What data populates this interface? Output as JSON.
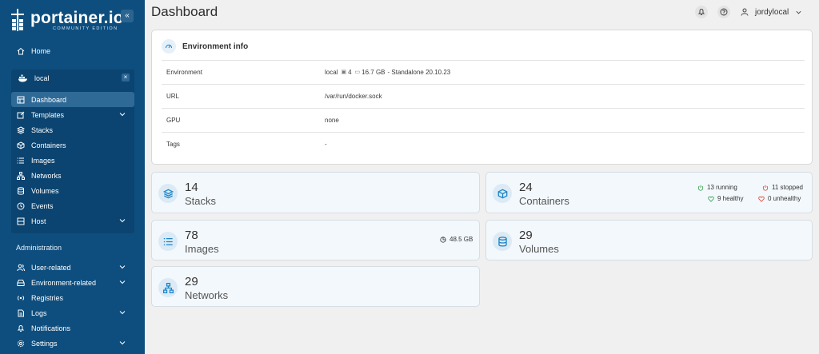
{
  "brand": {
    "name": "portainer.io",
    "edition": "COMMUNITY EDITION"
  },
  "sidebar": {
    "collapse_icon": "«",
    "home": "Home",
    "environment": {
      "name": "local",
      "close": "×"
    },
    "env_items": [
      {
        "label": "Dashboard",
        "icon": "dashboard-icon",
        "active": true
      },
      {
        "label": "Templates",
        "icon": "edit-icon",
        "chevron": true
      },
      {
        "label": "Stacks",
        "icon": "layers-icon"
      },
      {
        "label": "Containers",
        "icon": "box-icon"
      },
      {
        "label": "Images",
        "icon": "list-icon"
      },
      {
        "label": "Networks",
        "icon": "network-icon"
      },
      {
        "label": "Volumes",
        "icon": "database-icon"
      },
      {
        "label": "Events",
        "icon": "clock-icon"
      },
      {
        "label": "Host",
        "icon": "server-icon",
        "chevron": true
      }
    ],
    "admin_title": "Administration",
    "admin_items": [
      {
        "label": "User-related",
        "chevron": true
      },
      {
        "label": "Environment-related",
        "chevron": true
      },
      {
        "label": "Registries"
      },
      {
        "label": "Logs",
        "chevron": true
      },
      {
        "label": "Notifications"
      },
      {
        "label": "Settings",
        "chevron": true
      }
    ]
  },
  "header": {
    "title": "Dashboard",
    "username": "jordylocal"
  },
  "env_info": {
    "title": "Environment info",
    "rows": [
      {
        "key": "Environment",
        "name": "local",
        "cpu": "4",
        "mem": "16.7 GB",
        "rest": "- Standalone 20.10.23"
      },
      {
        "key": "URL",
        "value": "/var/run/docker.sock"
      },
      {
        "key": "GPU",
        "value": "none"
      },
      {
        "key": "Tags",
        "value": "-"
      }
    ]
  },
  "stats": {
    "stacks": {
      "count": "14",
      "label": "Stacks"
    },
    "containers": {
      "count": "24",
      "label": "Containers",
      "running": "13 running",
      "stopped": "11 stopped",
      "healthy": "9 healthy",
      "unhealthy": "0 unhealthy"
    },
    "images": {
      "count": "78",
      "label": "Images",
      "size": "48.5 GB"
    },
    "volumes": {
      "count": "29",
      "label": "Volumes"
    },
    "networks": {
      "count": "29",
      "label": "Networks"
    }
  },
  "colors": {
    "sidebar": "#0e4e7e",
    "accent": "#1d85c7",
    "running": "#2e9d4a",
    "stopped": "#d9432f"
  }
}
